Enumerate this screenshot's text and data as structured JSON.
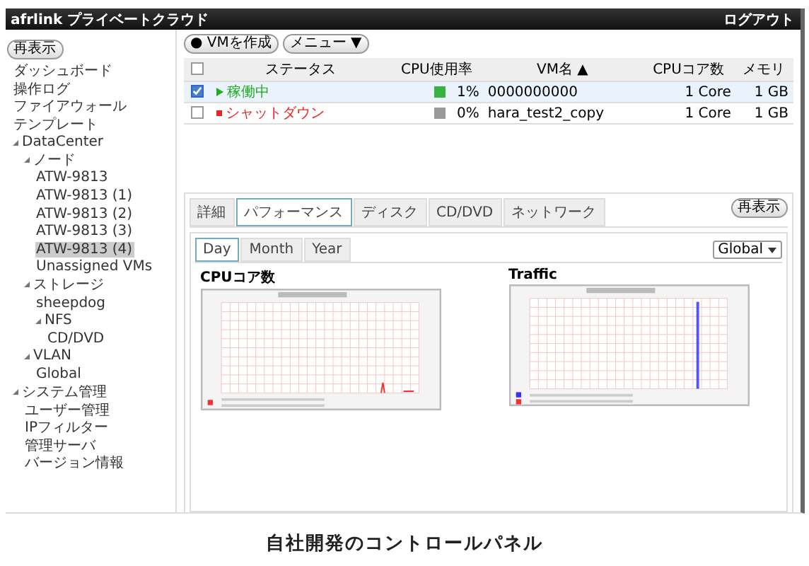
{
  "header": {
    "title": "afrlink プライベートクラウド",
    "logout": "ログアウト"
  },
  "sidebar": {
    "refresh": "再表示",
    "items": [
      {
        "label": "ダッシュボード"
      },
      {
        "label": "操作ログ"
      },
      {
        "label": "ファイアウォール"
      },
      {
        "label": "テンプレート"
      },
      {
        "label": "DataCenter",
        "expanded": true,
        "children": [
          {
            "label": "ノード",
            "expanded": true,
            "children": [
              {
                "label": "ATW-9813",
                "selected": false
              },
              {
                "label": "ATW-9813 (1)",
                "selected": false
              },
              {
                "label": "ATW-9813 (2)",
                "selected": false
              },
              {
                "label": "ATW-9813 (3)",
                "selected": false
              },
              {
                "label": "ATW-9813 (4)",
                "selected": true
              },
              {
                "label": "Unassigned VMs",
                "selected": false
              }
            ]
          },
          {
            "label": "ストレージ",
            "expanded": true,
            "children": [
              {
                "label": "sheepdog"
              },
              {
                "label": "NFS",
                "expanded": true,
                "children": [
                  {
                    "label": "CD/DVD"
                  }
                ]
              }
            ]
          },
          {
            "label": "VLAN",
            "expanded": true,
            "children": [
              {
                "label": "Global"
              }
            ]
          }
        ]
      },
      {
        "label": "システム管理",
        "expanded": true,
        "children": [
          {
            "label": "ユーザー管理"
          },
          {
            "label": "IPフィルター"
          },
          {
            "label": "管理サーバ"
          },
          {
            "label": "バージョン情報"
          }
        ]
      }
    ]
  },
  "toolbar": [
    "● VMを作成",
    "メニュー ▼"
  ],
  "table": {
    "all_checked": false,
    "columns": [
      "ステータス",
      "CPU使用率",
      "VM名 ▲",
      "CPUコア数",
      "メモリ"
    ],
    "rows": [
      {
        "checked": true,
        "selected": true,
        "status": "稼働中",
        "kind": "running",
        "color": "#3cb043",
        "cpu": "1%",
        "name": "0000000000",
        "cores": "1 Core",
        "memory": "1 GB"
      },
      {
        "checked": false,
        "selected": false,
        "status": "シャットダウン",
        "kind": "stopped",
        "color": "#999999",
        "cpu": "0%",
        "name": "hara_test2_copy",
        "cores": "1 Core",
        "memory": "1 GB"
      }
    ]
  },
  "detail": {
    "tabs": [
      {
        "label": "詳細",
        "selected": false
      },
      {
        "label": "パフォーマンス",
        "selected": true
      },
      {
        "label": "ディスク",
        "selected": false
      },
      {
        "label": "CD/DVD",
        "selected": false
      },
      {
        "label": "ネットワーク",
        "selected": false
      }
    ],
    "refresh": "再表示",
    "periods": [
      {
        "label": "Day",
        "selected": true
      },
      {
        "label": "Month",
        "selected": false
      },
      {
        "label": "Year",
        "selected": false
      }
    ],
    "network": "Global",
    "charts": [
      {
        "title": "CPUコア数",
        "kind": "cpu"
      },
      {
        "title": "Traffic",
        "kind": "traffic"
      }
    ]
  },
  "caption": "自社開発のコントロールパネル"
}
